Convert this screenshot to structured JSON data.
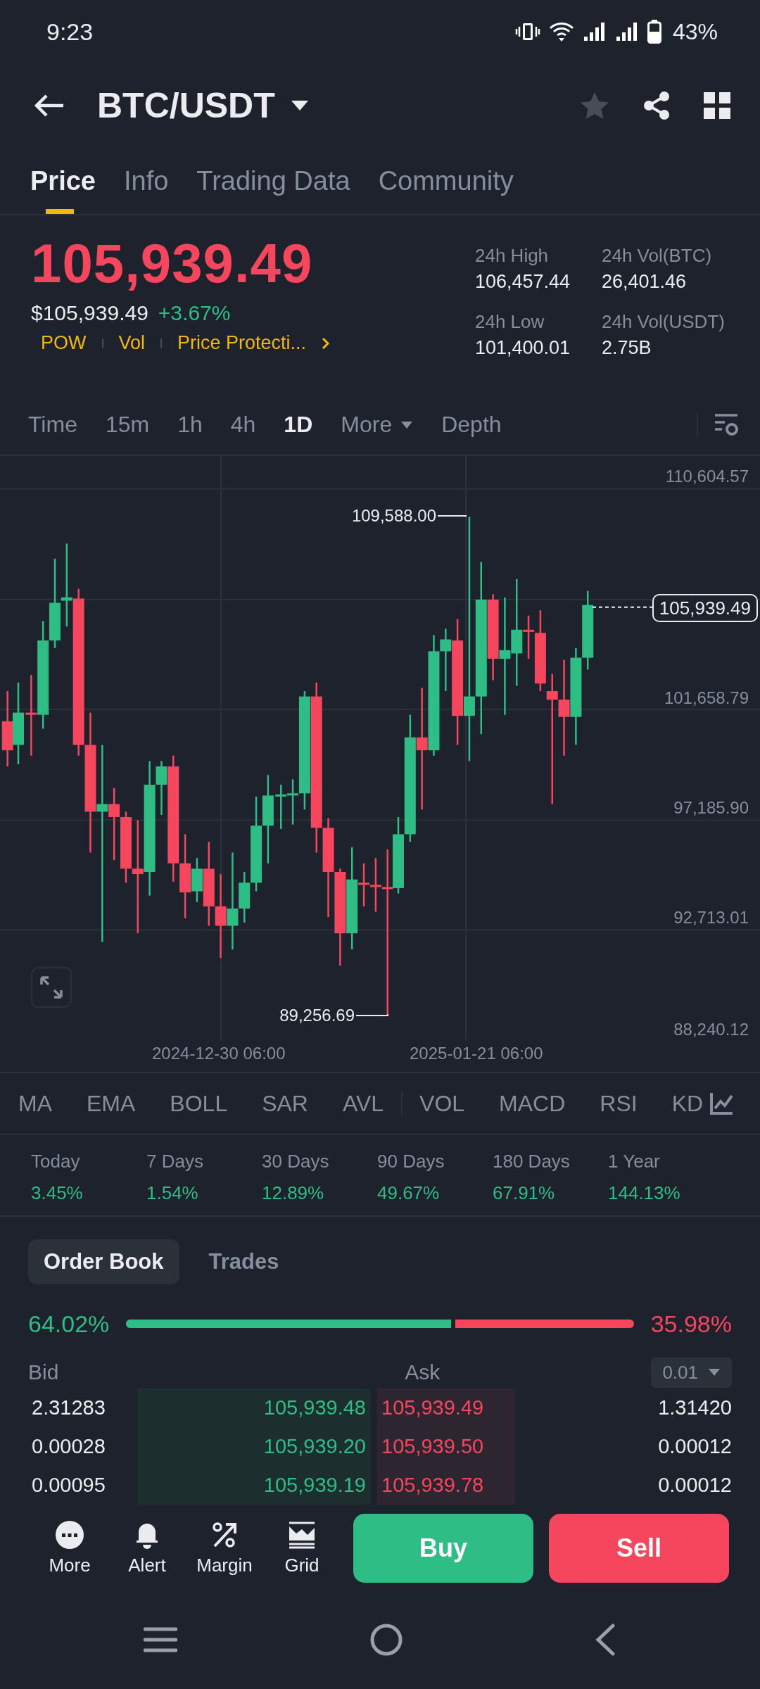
{
  "status_bar": {
    "time": "9:23",
    "battery": "43%"
  },
  "header": {
    "pair": "BTC/USDT",
    "favorite": false
  },
  "tabs": [
    {
      "label": "Price",
      "selected": true
    },
    {
      "label": "Info",
      "selected": false
    },
    {
      "label": "Trading Data",
      "selected": false
    },
    {
      "label": "Community",
      "selected": false
    }
  ],
  "price": {
    "last": "105,939.49",
    "usd": "$105,939.49",
    "change": "+3.67%",
    "tags": [
      "POW",
      "Vol",
      "Price Protecti..."
    ]
  },
  "stats": [
    {
      "label": "24h High",
      "value": "106,457.44"
    },
    {
      "label": "24h Vol(BTC)",
      "value": "26,401.46"
    },
    {
      "label": "24h Low",
      "value": "101,400.01"
    },
    {
      "label": "24h Vol(USDT)",
      "value": "2.75B"
    }
  ],
  "intervals": [
    {
      "label": "Time",
      "selected": false
    },
    {
      "label": "15m",
      "selected": false
    },
    {
      "label": "1h",
      "selected": false
    },
    {
      "label": "4h",
      "selected": false
    },
    {
      "label": "1D",
      "selected": true
    },
    {
      "label": "More",
      "selected": false,
      "kind": "dropdown"
    },
    {
      "label": "Depth",
      "selected": false
    }
  ],
  "chart": {
    "price_ticks": [
      "110,604.57",
      "101,658.79",
      "97,185.90",
      "92,713.01",
      "88,240.12"
    ],
    "high_label": "109,588.00",
    "low_label": "89,256.69",
    "current_price": "105,939.49",
    "dates": [
      "2024-12-30 06:00",
      "2025-01-21 06:00"
    ]
  },
  "indicators": [
    "MA",
    "EMA",
    "BOLL",
    "SAR",
    "AVL",
    "VOL",
    "MACD",
    "RSI",
    "KD"
  ],
  "performance": [
    {
      "label": "Today",
      "value": "3.45%"
    },
    {
      "label": "7 Days",
      "value": "1.54%"
    },
    {
      "label": "30 Days",
      "value": "12.89%"
    },
    {
      "label": "90 Days",
      "value": "49.67%"
    },
    {
      "label": "180 Days",
      "value": "67.91%"
    },
    {
      "label": "1 Year",
      "value": "144.13%"
    }
  ],
  "order_book": {
    "tabs": [
      {
        "label": "Order Book",
        "selected": true
      },
      {
        "label": "Trades",
        "selected": false
      }
    ],
    "ratio": {
      "bid": "64.02%",
      "ask": "35.98%",
      "level": 0.6402
    },
    "bid_header": "Bid",
    "ask_header": "Ask",
    "precision": "0.01",
    "rows": [
      {
        "bid_qty": "2.31283",
        "bid_price": "105,939.48",
        "ask_price": "105,939.49",
        "ask_qty": "1.31420"
      },
      {
        "bid_qty": "0.00028",
        "bid_price": "105,939.20",
        "ask_price": "105,939.50",
        "ask_qty": "0.00012"
      },
      {
        "bid_qty": "0.00095",
        "bid_price": "105,939.19",
        "ask_price": "105,939.78",
        "ask_qty": "0.00012"
      }
    ]
  },
  "actions": [
    {
      "label": "More",
      "kind": "more"
    },
    {
      "label": "Alert",
      "kind": "alert"
    },
    {
      "label": "Margin",
      "kind": "margin"
    },
    {
      "label": "Grid",
      "kind": "grid"
    }
  ],
  "buy": "Buy",
  "sell": "Sell"
}
